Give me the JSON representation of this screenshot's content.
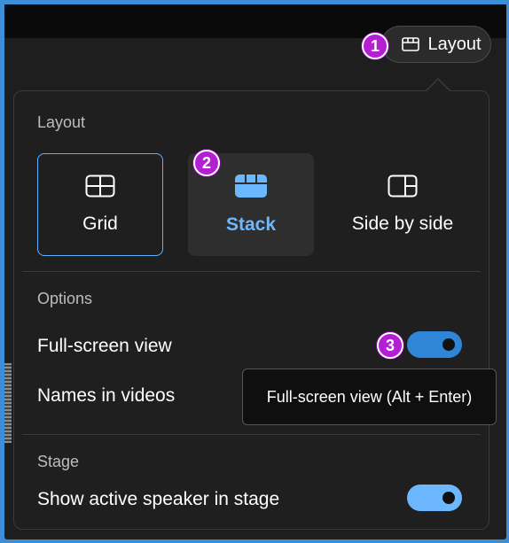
{
  "header": {
    "layout_button_label": "Layout"
  },
  "badges": [
    "1",
    "2",
    "3"
  ],
  "layout_section": {
    "title": "Layout",
    "options": [
      {
        "label": "Grid",
        "icon": "grid-icon",
        "selected": false
      },
      {
        "label": "Stack",
        "icon": "stack-icon",
        "selected": true
      },
      {
        "label": "Side by side",
        "icon": "side-by-side-icon",
        "selected": false
      }
    ]
  },
  "options_section": {
    "title": "Options",
    "full_screen_label": "Full-screen view",
    "full_screen_on": true,
    "names_label": "Names in videos"
  },
  "tooltip": {
    "text": "Full-screen view (Alt + Enter)"
  },
  "stage_section": {
    "title": "Stage",
    "active_speaker_label": "Show active speaker in stage",
    "active_speaker_on": true
  },
  "colors": {
    "accent": "#2f86d8",
    "selected_text": "#6cb8ff",
    "badge": "#b51fd4"
  }
}
